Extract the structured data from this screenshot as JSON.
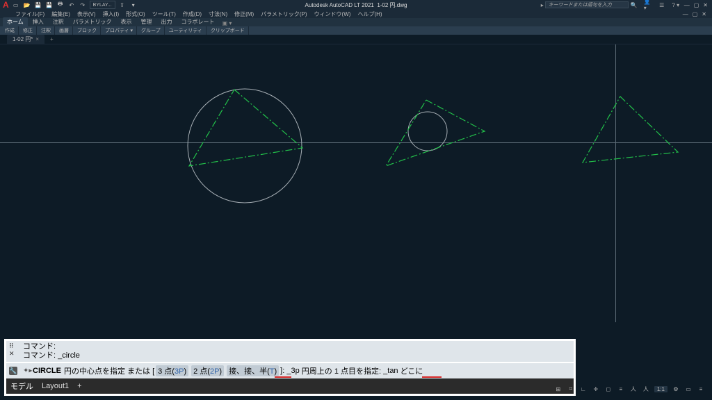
{
  "app": {
    "title_prefix": "Autodesk AutoCAD LT 2021",
    "document_name": "1-02 円.dwg",
    "search_placeholder": "キーワードまたは語句を入力"
  },
  "menubar": [
    "ファイル(F)",
    "編集(E)",
    "表示(V)",
    "挿入(I)",
    "形式(O)",
    "ツール(T)",
    "作成(D)",
    "寸法(N)",
    "修正(M)",
    "パラメトリック(P)",
    "ウィンドウ(W)",
    "ヘルプ(H)"
  ],
  "ribbon_tabs": [
    "ホーム",
    "挿入",
    "注釈",
    "パラメトリック",
    "表示",
    "管理",
    "出力",
    "コラボレート"
  ],
  "ribbon_active": 0,
  "ribbon_panels": [
    "作成",
    "修正",
    "注釈",
    "画層",
    "ブロック",
    "プロパティ ▾",
    "グループ",
    "ユーティリティ",
    "クリップボード"
  ],
  "layer_display": "BYLAY...",
  "doc_tabs": [
    {
      "label": "1-02 円*"
    }
  ],
  "command": {
    "label_cmd": "コマンド:",
    "history": [
      "コマンド:",
      "コマンド: _circle"
    ],
    "name": "CIRCLE",
    "prompt_center": "円の中心点を指定 または [",
    "opt_3p_txt": "3 点(",
    "opt_3p_key": "3P",
    "opt_2p_txt": "2 点(",
    "opt_2p_key": "2P",
    "opt_ttr_txt": "接、接、半(",
    "opt_ttr_key": "T",
    "close_bracket": ")]:",
    "entered_3p": "_3p",
    "prompt_pt1": "円周上の 1 点目を指定:",
    "entered_tan": "_tan",
    "prompt_where": "どこに"
  },
  "bottom_tabs": [
    "モデル",
    "Layout1"
  ],
  "bottom_active": 0,
  "status": {
    "ratio": "1:1"
  }
}
